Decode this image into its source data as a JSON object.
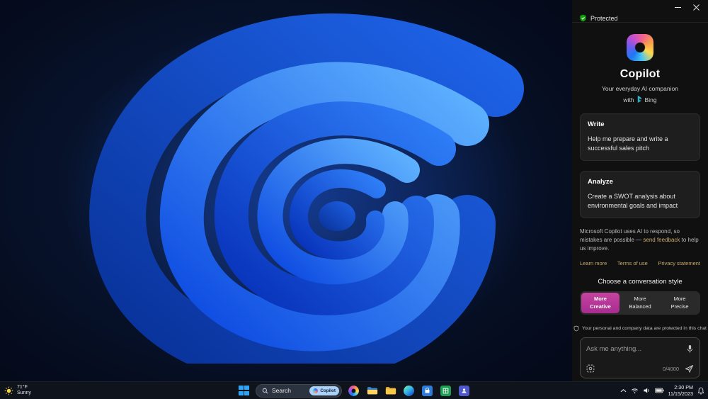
{
  "colors": {
    "accent_pink": "#b42f9d",
    "protected_green": "#13a10e",
    "link_gold": "#c9a96d",
    "wallpaper_blue": "#2f7ef8"
  },
  "copilot_panel": {
    "protected_label": "Protected",
    "title": "Copilot",
    "subtitle": "Your everyday AI companion",
    "with_label": "with",
    "bing_label": "Bing",
    "cards": [
      {
        "title": "Write",
        "body": "Help me prepare and write a successful sales pitch"
      },
      {
        "title": "Analyze",
        "body": "Create a SWOT analysis about environmental goals and impact"
      }
    ],
    "disclaimer_part1": "Microsoft Copilot uses AI to respond, so mistakes are possible — ",
    "feedback_link": "send feedback",
    "disclaimer_part2": " to help us improve.",
    "links": [
      "Learn more",
      "Terms of use",
      "Privacy statement"
    ],
    "style_chooser": {
      "label": "Choose a conversation style",
      "options": [
        {
          "line1": "More",
          "line2": "Creative",
          "selected": true
        },
        {
          "line1": "More",
          "line2": "Balanced",
          "selected": false
        },
        {
          "line1": "More",
          "line2": "Precise",
          "selected": false
        }
      ]
    },
    "privacy_note": "Your personal and company data are protected in this chat",
    "composer": {
      "placeholder": "Ask me anything...",
      "char_count": "0/4000"
    }
  },
  "taskbar": {
    "weather": {
      "temp": "71°F",
      "condition": "Sunny"
    },
    "search": {
      "label": "Search",
      "badge": "Copilot"
    },
    "clock": {
      "time": "2:30 PM",
      "date": "11/15/2023"
    }
  }
}
